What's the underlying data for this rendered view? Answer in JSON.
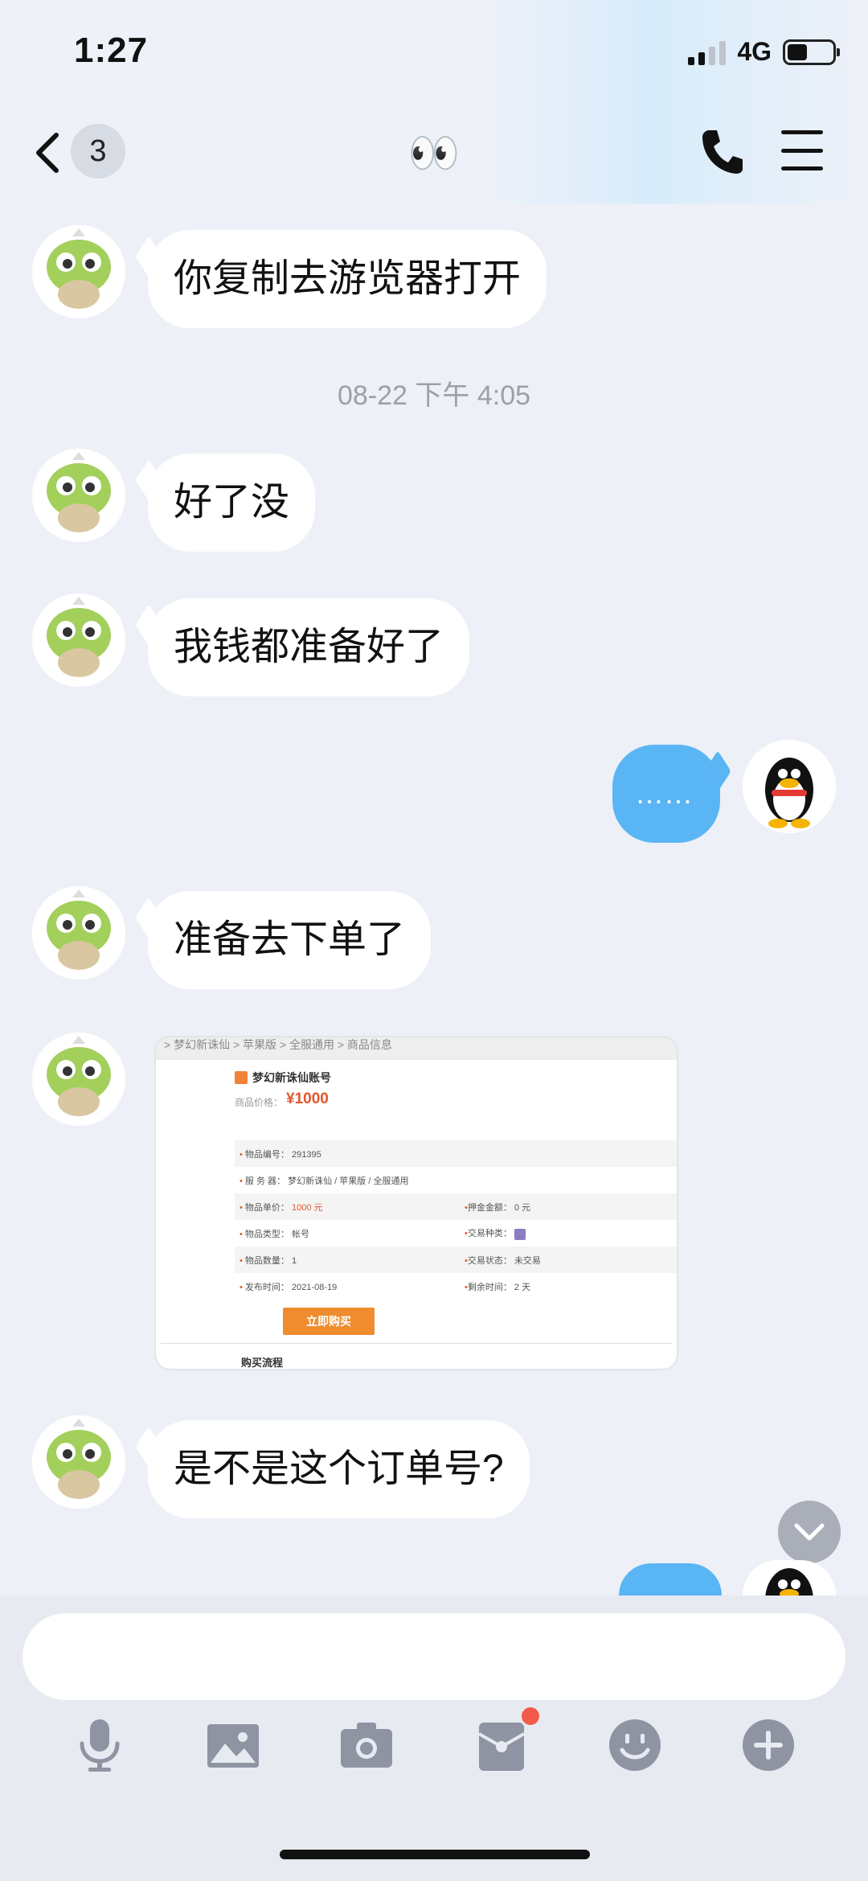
{
  "status": {
    "time": "1:27",
    "network": "4G"
  },
  "nav": {
    "unread_count": "3",
    "title": "👀"
  },
  "messages": [
    {
      "side": "left",
      "text": "你复制去游览器打开"
    },
    {
      "side": "left",
      "text": "好了没"
    },
    {
      "side": "left",
      "text": "我钱都准备好了"
    },
    {
      "side": "right",
      "text": "……"
    },
    {
      "side": "left",
      "text": "准备去下单了"
    },
    {
      "side": "left",
      "text": "是不是这个订单号?"
    }
  ],
  "timestamp": "08-22 下午 4:05",
  "screenshot": {
    "breadcrumb": "> 梦幻新诛仙 > 苹果版 > 全服通用 > 商品信息",
    "title": "梦幻新诛仙账号",
    "price_label": "商品价格：",
    "price": "¥1000",
    "rows": [
      {
        "l1": "物品编号：",
        "v1": "291395",
        "l2": "",
        "v2": ""
      },
      {
        "l1": "服 务 器：",
        "v1": "梦幻新诛仙 / 苹果版 / 全服通用",
        "l2": "",
        "v2": ""
      },
      {
        "l1": "物品单价：",
        "v1": "1000 元",
        "l2": "押金金额：",
        "v2": "0 元"
      },
      {
        "l1": "物品类型：",
        "v1": "帐号",
        "l2": "交易种类：",
        "v2": ""
      },
      {
        "l1": "物品数量：",
        "v1": "1",
        "l2": "交易状态：",
        "v2": "未交易"
      },
      {
        "l1": "发布时间：",
        "v1": "2021-08-19",
        "l2": "剩余时间：",
        "v2": "2 天"
      }
    ],
    "buy_label": "立即购买",
    "flow_label": "购买流程"
  },
  "colors": {
    "accent": "#5ab5f5",
    "background": "#eef0f7",
    "badge_red": "#f25a4a",
    "price": "#e0562b"
  },
  "icons": [
    "back-chevron-icon",
    "phone-icon",
    "menu-icon",
    "microphone-icon",
    "image-icon",
    "camera-icon",
    "red-packet-icon",
    "emoji-icon",
    "plus-icon",
    "chevron-down-icon"
  ]
}
